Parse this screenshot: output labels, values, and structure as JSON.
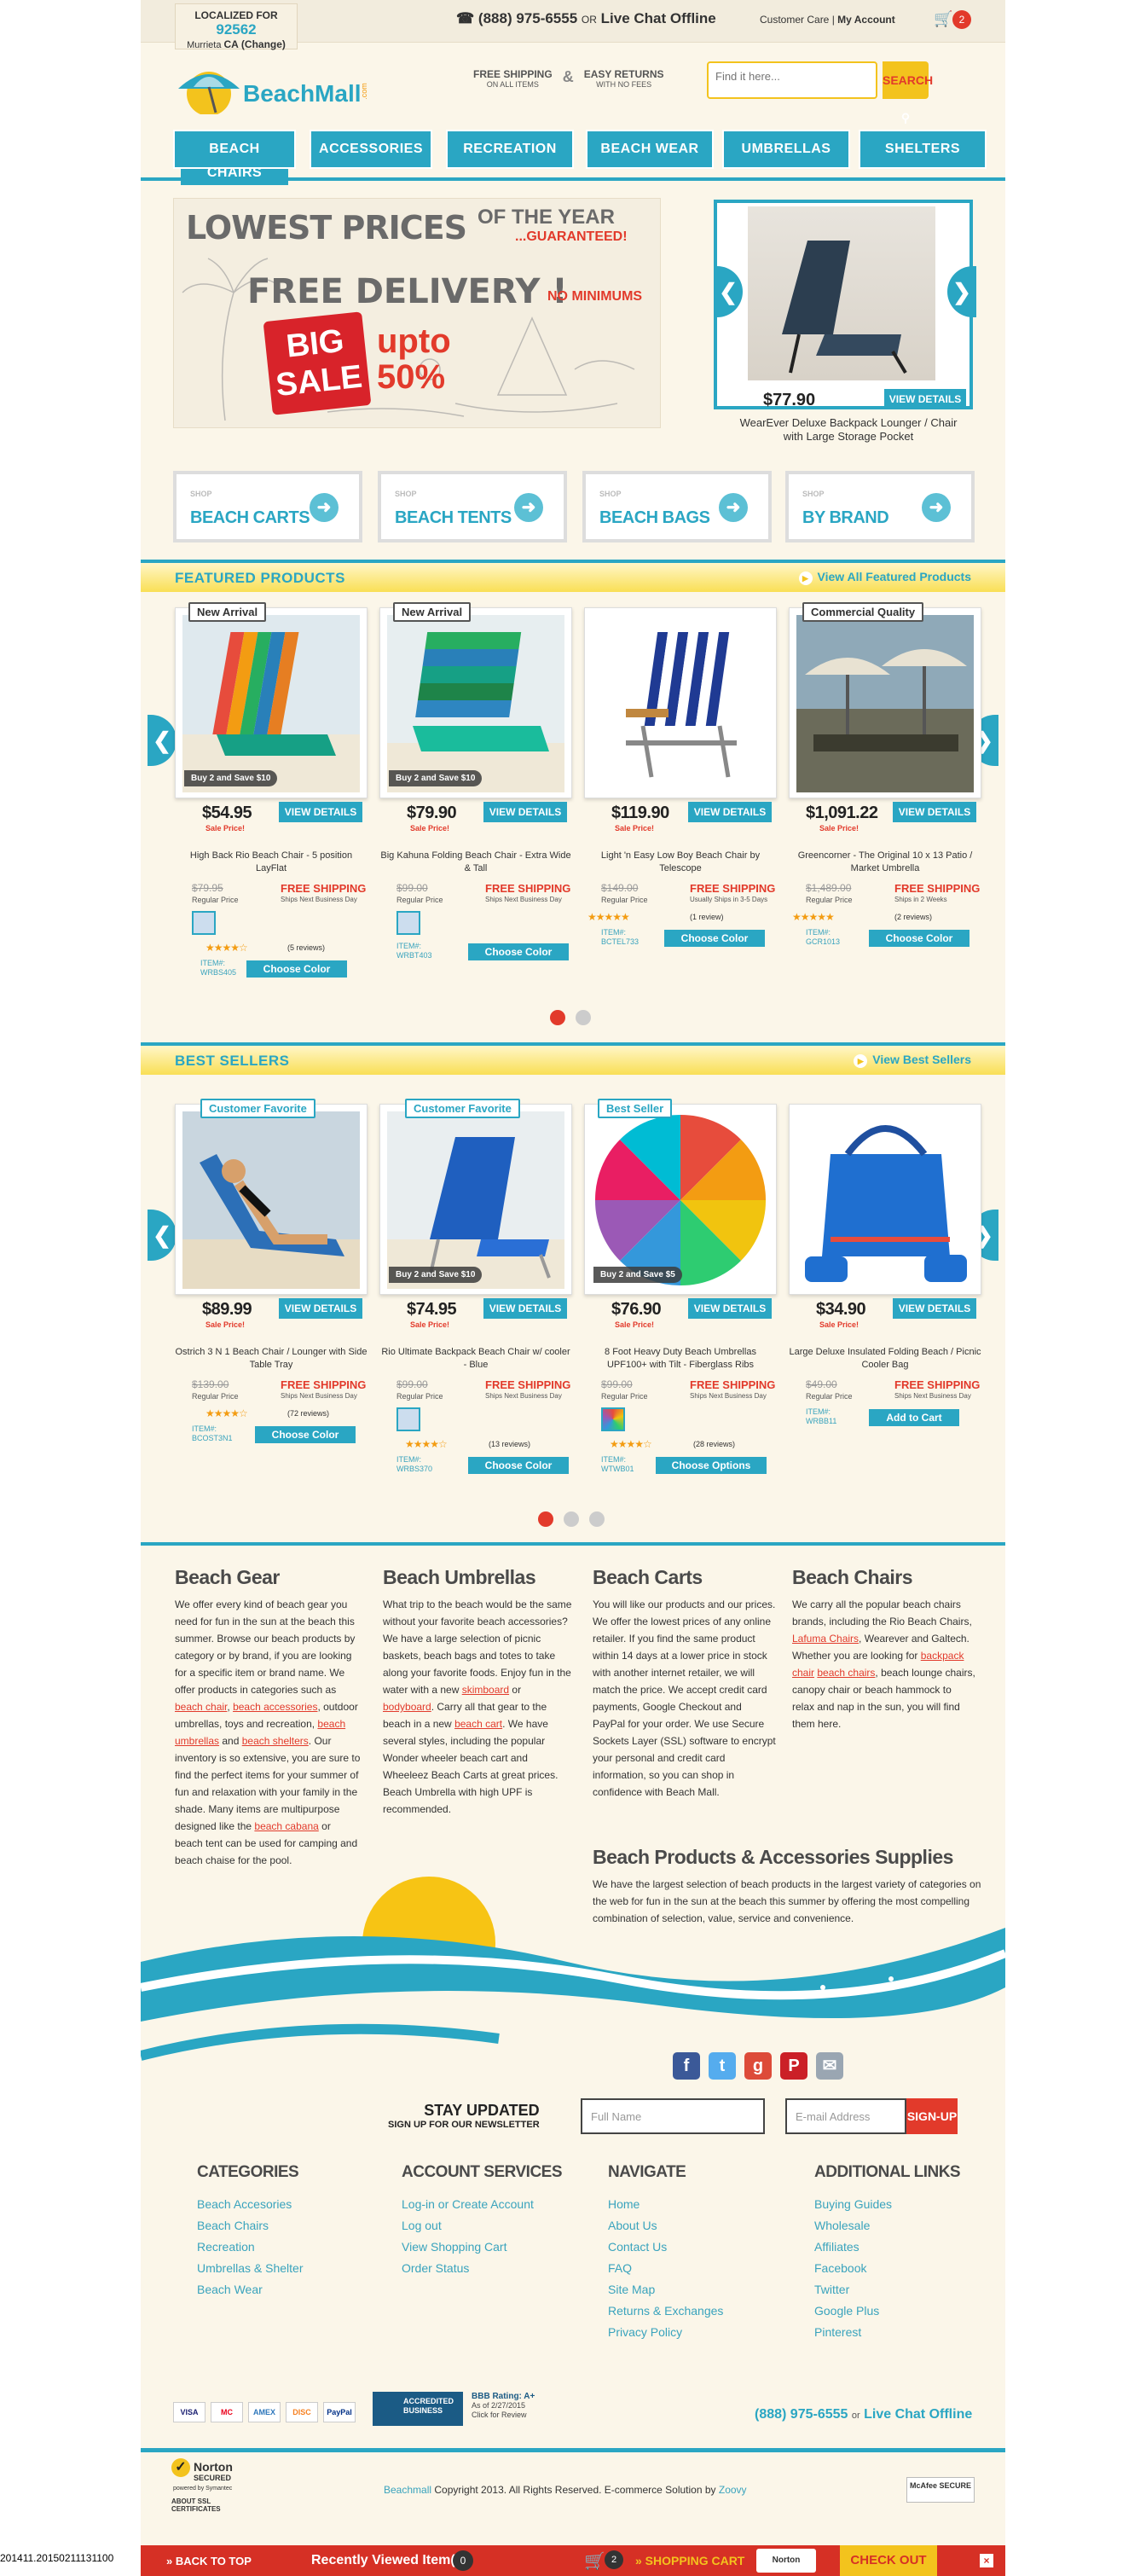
{
  "topbar": {
    "localized_label": "LOCALIZED FOR",
    "zip": "92562",
    "city": "Murrieta",
    "state": "CA",
    "change": "(Change)",
    "phone": "(888) 975-6555",
    "or": "OR",
    "chat": "Live Chat Offline",
    "customer_care": "Customer Care",
    "separator": "|",
    "my_account": "My Account",
    "cart_count": "2"
  },
  "header": {
    "logo_text": "BeachMall",
    "logo_sub": ".com",
    "free_shipping": "FREE SHIPPING",
    "free_shipping_sub": "ON ALL ITEMS",
    "easy_returns": "EASY RETURNS",
    "easy_returns_sub": "WITH NO FEES",
    "search_placeholder": "Find it here...",
    "search_button": "SEARCH"
  },
  "nav": [
    "BEACH CHAIRS",
    "ACCESSORIES",
    "RECREATION",
    "BEACH WEAR",
    "UMBRELLAS",
    "SHELTERS"
  ],
  "promo": {
    "line1": "LOWEST PRICES",
    "line1b": "OF THE YEAR",
    "line1c": "...GUARANTEED!",
    "line2": "FREE DELIVERY !",
    "line2b": "NO MINIMUMS",
    "big": "BIG",
    "sale": "SALE",
    "upto": "upto",
    "pct": "50%"
  },
  "featured_slide": {
    "price": "$77.90",
    "button": "VIEW DETAILS",
    "name": "WearEver Deluxe Backpack Lounger / Chair with Large Storage Pocket"
  },
  "shop_boxes": [
    {
      "kicker": "SHOP",
      "label": "BEACH CARTS"
    },
    {
      "kicker": "SHOP",
      "label": "BEACH TENTS"
    },
    {
      "kicker": "SHOP",
      "label": "BEACH BAGS"
    },
    {
      "kicker": "SHOP",
      "label": "BY BRAND"
    }
  ],
  "featured": {
    "title": "FEATURED PRODUCTS",
    "view_all": "View All Featured Products",
    "products": [
      {
        "tag": "New Arrival",
        "promo": "Buy 2 and Save $10",
        "price": "$54.95",
        "sale": "Sale Price!",
        "btn": "VIEW DETAILS",
        "name": "High Back Rio Beach Chair - 5 position LayFlat",
        "reg": "$79.95",
        "reg_label": "Regular Price",
        "fs": "FREE SHIPPING",
        "fs_note": "Ships Next Business Day",
        "reviews": "(5 reviews)",
        "item_label": "ITEM#:",
        "item": "WRBS405",
        "choose": "Choose Color"
      },
      {
        "tag": "New Arrival",
        "promo": "Buy 2 and Save $10",
        "price": "$79.90",
        "sale": "Sale Price!",
        "btn": "VIEW DETAILS",
        "name": "Big Kahuna Folding Beach Chair - Extra Wide & Tall",
        "reg": "$99.00",
        "reg_label": "Regular Price",
        "fs": "FREE SHIPPING",
        "fs_note": "Ships Next Business Day",
        "item_label": "ITEM#:",
        "item": "WRBT403",
        "choose": "Choose Color"
      },
      {
        "tag": "",
        "promo": "",
        "price": "$119.90",
        "sale": "Sale Price!",
        "btn": "VIEW DETAILS",
        "name": "Light 'n Easy Low Boy Beach Chair by Telescope",
        "reg": "$149.00",
        "reg_label": "Regular Price",
        "fs": "FREE SHIPPING",
        "fs_note": "Usually Ships in 3-5 Days",
        "reviews": "(1 review)",
        "item_label": "ITEM#:",
        "item": "BCTEL733",
        "choose": "Choose Color"
      },
      {
        "tag": "Commercial Quality",
        "promo": "",
        "price": "$1,091.22",
        "sale": "Sale Price!",
        "btn": "VIEW DETAILS",
        "name": "Greencorner - The Original 10 x 13 Patio / Market Umbrella",
        "reg": "$1,489.00",
        "reg_label": "Regular Price",
        "fs": "FREE SHIPPING",
        "fs_note": "Ships in 2 Weeks",
        "reviews": "(2 reviews)",
        "item_label": "ITEM#:",
        "item": "GCR1013",
        "choose": "Choose Color"
      }
    ]
  },
  "bestsellers": {
    "title": "BEST SELLERS",
    "view_all": "View Best Sellers",
    "products": [
      {
        "tag": "Customer Favorite",
        "promo": "",
        "price": "$89.99",
        "sale": "Sale Price!",
        "btn": "VIEW DETAILS",
        "name": "Ostrich 3 N 1 Beach Chair / Lounger with Side Table Tray",
        "reg": "$139.00",
        "reg_label": "Regular Price",
        "fs": "FREE SHIPPING",
        "fs_note": "Ships Next Business Day",
        "reviews": "(72 reviews)",
        "item_label": "ITEM#:",
        "item": "BCOST3N1",
        "choose": "Choose Color"
      },
      {
        "tag": "Customer Favorite",
        "promo": "Buy 2 and Save $10",
        "price": "$74.95",
        "sale": "Sale Price!",
        "btn": "VIEW DETAILS",
        "name": "Rio Ultimate Backpack Beach Chair w/ cooler - Blue",
        "reg": "$99.00",
        "reg_label": "Regular Price",
        "fs": "FREE SHIPPING",
        "fs_note": "Ships Next Business Day",
        "reviews": "(13 reviews)",
        "item_label": "ITEM#:",
        "item": "WRBS370",
        "choose": "Choose Color"
      },
      {
        "tag": "Best Seller",
        "promo": "Buy 2 and Save $5",
        "price": "$76.90",
        "sale": "Sale Price!",
        "btn": "VIEW DETAILS",
        "name": "8 Foot Heavy Duty Beach Umbrellas UPF100+ with Tilt - Fiberglass Ribs",
        "reg": "$99.00",
        "reg_label": "Regular Price",
        "fs": "FREE SHIPPING",
        "fs_note": "Ships Next Business Day",
        "reviews": "(28 reviews)",
        "item_label": "ITEM#:",
        "item": "WTWB01",
        "choose": "Choose Options"
      },
      {
        "tag": "",
        "promo": "",
        "price": "$34.90",
        "sale": "Sale Price!",
        "btn": "VIEW DETAILS",
        "name": "Large Deluxe Insulated Folding Beach / Picnic Cooler Bag",
        "reg": "$49.00",
        "reg_label": "Regular Price",
        "fs": "FREE SHIPPING",
        "fs_note": "Ships Next Business Day",
        "item_label": "ITEM#:",
        "item": "WRBB11",
        "choose": "Add to Cart"
      }
    ]
  },
  "info": {
    "gear_title": "Beach Gear",
    "gear_text_1": "We offer every kind of beach gear you need for fun in the sun at the beach this summer. Browse our beach products by category or by brand, if you are looking for a specific item or brand name. We offer products in categories such as ",
    "gear_link_1": "beach chair",
    "gear_text_2": ", ",
    "gear_link_2": "beach accessories",
    "gear_text_3": ", outdoor umbrellas, toys and recreation, ",
    "gear_link_3": "beach umbrellas",
    "gear_text_4": " and ",
    "gear_link_4": "beach shelters",
    "gear_text_5": ". Our inventory is so extensive, you are sure to find the perfect items for your summer of fun and relaxation with your family in the shade. Many items are multipurpose designed like the ",
    "gear_link_5": "beach cabana",
    "gear_text_6": " or beach tent can be used for camping and beach chaise for the pool.",
    "umb_title": "Beach Umbrellas",
    "umb_text_1": "What trip to the beach would be the same without your favorite beach accessories? We have a large selection of picnic baskets, beach bags and totes to take along your favorite foods. Enjoy fun in the water with a new ",
    "umb_link_1": "skimboard",
    "umb_text_2": " or ",
    "umb_link_2": "bodyboard",
    "umb_text_3": ". Carry all that gear to the beach in a new ",
    "umb_link_3": "beach cart",
    "umb_text_4": ". We have several styles, including the popular Wonder wheeler beach cart and Wheeleez Beach Carts at great prices. Beach Umbrella with high UPF is recommended.",
    "carts_title": "Beach Carts",
    "carts_text": "You will like our products and our prices. We offer the lowest prices of any online retailer. If you find the same product within 14 days at a lower price in stock with another internet retailer, we will match the price. We accept credit card payments, Google Checkout and PayPal for your order. We use Secure Sockets Layer (SSL) software to encrypt your personal and credit card information, so you can shop in confidence with Beach Mall.",
    "chairs_title": "Beach Chairs",
    "chairs_text_1": "We carry all the popular beach chairs brands, including the Rio Beach Chairs, ",
    "chairs_link_1": "Lafuma Chairs",
    "chairs_text_2": ", Wearever and Galtech. Whether you are looking for ",
    "chairs_link_2": "backpack chair",
    "chairs_text_3": " ",
    "chairs_link_3": "beach chairs",
    "chairs_text_4": ", beach lounge chairs, canopy chair or beach hammock to relax and nap in the sun, you will find them here.",
    "supplies_title": "Beach Products & Accessories Supplies",
    "supplies_text": "We have the largest selection of beach products in the largest variety of categories on the web for fun in the sun at the beach this summer by offering the most compelling combination of selection, value, service and convenience."
  },
  "newsletter": {
    "title": "STAY UPDATED",
    "subtitle": "SIGN UP FOR OUR NEWSLETTER",
    "name_placeholder": "Full Name",
    "email_placeholder": "E-mail Address",
    "button": "SIGN-UP"
  },
  "footer": {
    "categories_title": "CATEGORIES",
    "categories": [
      "Beach Accesories",
      "Beach Chairs",
      "Recreation",
      "Umbrellas & Shelter",
      "Beach Wear"
    ],
    "account_title": "ACCOUNT SERVICES",
    "account": [
      "Log-in or Create Account",
      "Log out",
      "View Shopping Cart",
      "Order Status"
    ],
    "navigate_title": "NAVIGATE",
    "navigate": [
      "Home",
      "About Us",
      "Contact Us",
      "FAQ",
      "Site Map",
      "Returns & Exchanges",
      "Privacy Policy"
    ],
    "links_title": "ADDITIONAL LINKS",
    "links": [
      "Buying Guides",
      "Wholesale",
      "Affiliates",
      "Facebook",
      "Twitter",
      "Google Plus",
      "Pinterest"
    ],
    "payments": [
      "VISA",
      "MC",
      "AMEX",
      "DISC",
      "PayPal"
    ],
    "bbb_label": "ACCREDITED BUSINESS",
    "bbb_rating": "BBB Rating: A+",
    "bbb_asof": "As of 2/27/2015",
    "bbb_click": "Click for Review",
    "phone": "(888) 975-6555",
    "or": "or",
    "chat": "Live Chat Offline",
    "norton": "Norton",
    "norton_sub": "SECURED",
    "norton_by": "powered by Symantec",
    "norton_about": "ABOUT SSL CERTIFICATES",
    "copyright_brand": "Beachmall",
    "copyright": " Copyright 2013. All Rights Reserved. E-commerce Solution by ",
    "copyright_vendor": "Zoovy",
    "mcafee": "McAfee SECURE"
  },
  "stamp": "201411.20150211131100",
  "bottombar": {
    "back": "» BACK TO TOP",
    "recent": "Recently Viewed Item(s)",
    "recent_count": "0",
    "cart_count": "2",
    "shopping_cart": "» SHOPPING CART",
    "norton": "Norton",
    "checkout": "CHECK OUT",
    "close": "×"
  },
  "colors": {
    "accent": "#2aa6c3",
    "red": "#e23a2b",
    "yellow": "#f3c31d",
    "cream": "#fbf6e9"
  }
}
